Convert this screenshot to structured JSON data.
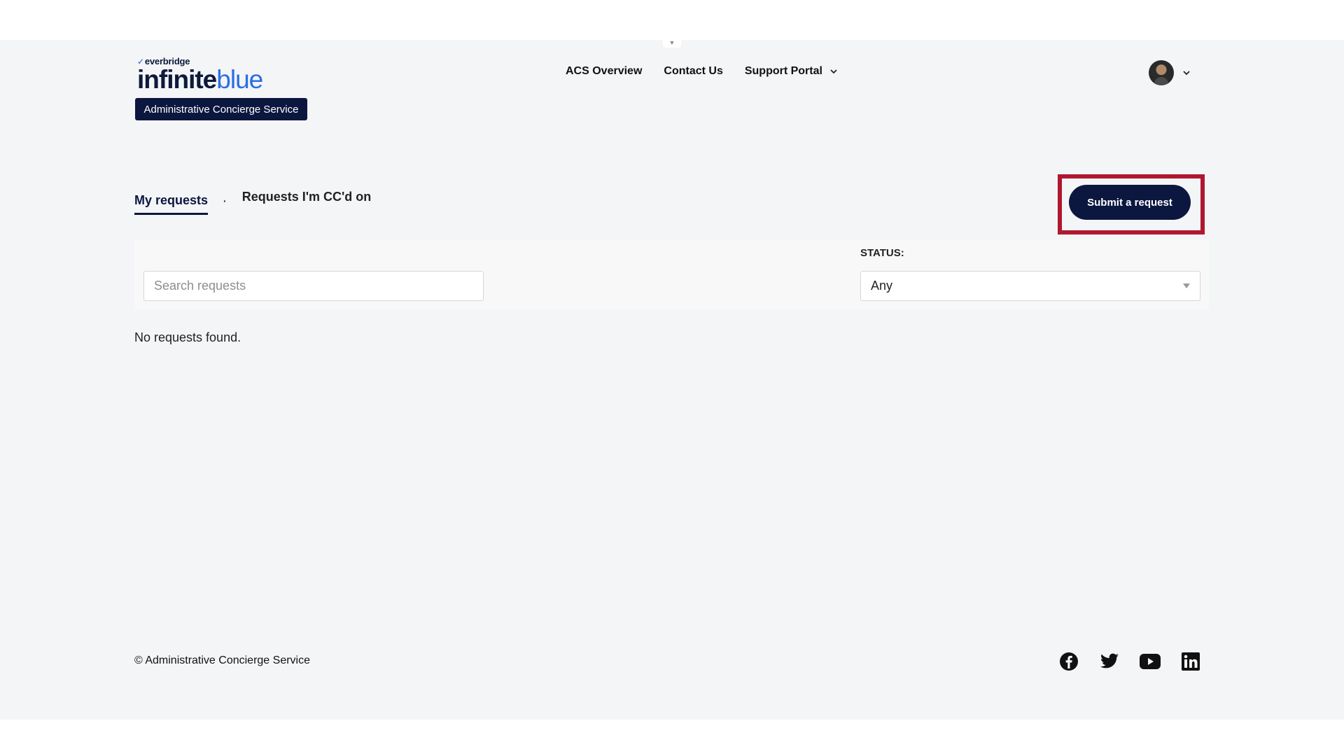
{
  "brand": {
    "parent": "everbridge",
    "name_part1": "infinite",
    "name_part2": "blue",
    "badge": "Administrative Concierge Service"
  },
  "nav": {
    "items": [
      {
        "label": "ACS Overview"
      },
      {
        "label": "Contact Us"
      },
      {
        "label": "Support Portal"
      }
    ]
  },
  "tabs": {
    "active": "My requests",
    "separator": "·",
    "other": "Requests I'm CC'd on"
  },
  "actions": {
    "submit_label": "Submit a request"
  },
  "filters": {
    "search_placeholder": "Search requests",
    "status_label": "STATUS:",
    "status_value": "Any"
  },
  "results": {
    "empty_message": "No requests found."
  },
  "footer": {
    "copyright": "© Administrative Concierge Service",
    "socials": [
      "facebook-icon",
      "twitter-icon",
      "youtube-icon",
      "linkedin-icon"
    ]
  },
  "colors": {
    "primary": "#0c1740",
    "accent_blue": "#2a6ee6",
    "highlight": "#b0172f",
    "page_bg": "#f4f5f7"
  }
}
